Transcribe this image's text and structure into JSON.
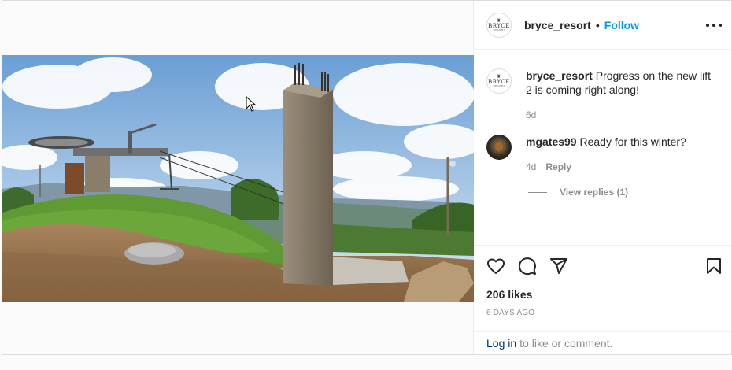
{
  "post": {
    "username": "bryce_resort",
    "dot": "•",
    "follow_label": "Follow",
    "avatar_logo_text": "BRYCE",
    "avatar_logo_sub": "RESORT",
    "caption_username": "bryce_resort",
    "caption_text": "Progress on the new lift 2 is coming right along!",
    "caption_age": "6d"
  },
  "comments": [
    {
      "username": "mgates99",
      "text": "Ready for this winter?",
      "age": "4d",
      "reply_label": "Reply",
      "view_replies": "View replies (1)"
    }
  ],
  "actions": {
    "likes": "206 likes",
    "time_ago": "6 DAYS AGO",
    "icons": [
      "heart-icon",
      "comment-icon",
      "share-icon",
      "bookmark-icon"
    ]
  },
  "login": {
    "link": "Log in",
    "rest": "to like or comment."
  },
  "colors": {
    "accent": "#0095f6",
    "link_dark": "#00376b",
    "muted": "#8e8e8e",
    "text": "#262626"
  }
}
